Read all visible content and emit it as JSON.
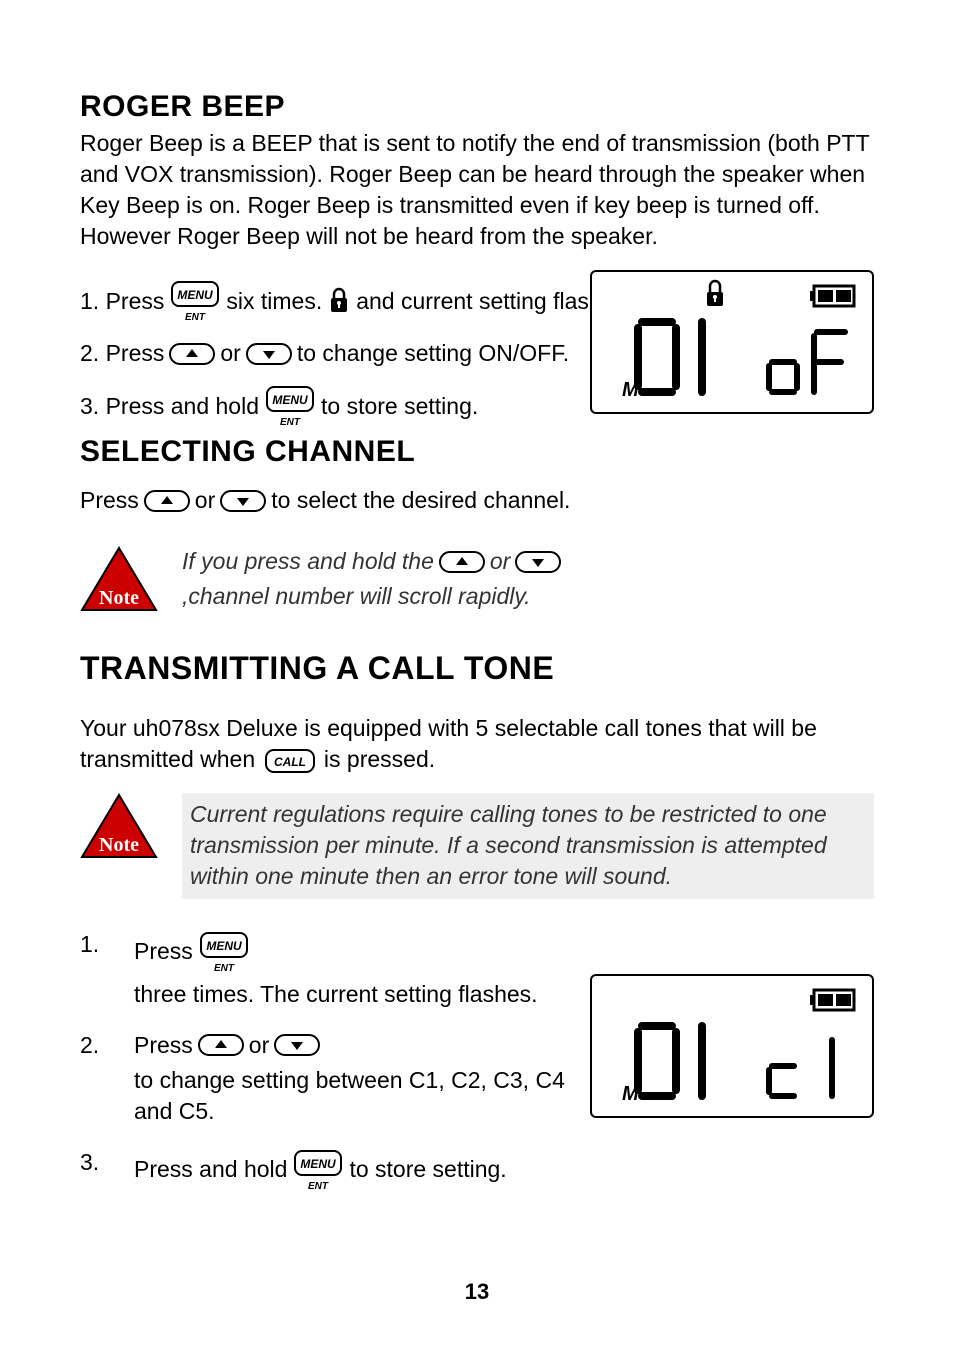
{
  "page_number": "13",
  "sections": {
    "roger_beep": {
      "title": "ROGER BEEP",
      "body": "Roger Beep is a BEEP that is sent to notify the end of transmission (both PTT and VOX transmission). Roger Beep can be heard through the speaker when Key Beep is on. Roger Beep is transmitted even if key beep is turned off. However Roger Beep will not be heard from the speaker.",
      "steps": {
        "s1a": "1. Press",
        "s1b": "six times.",
        "s1c": "and current setting flashes.",
        "s2a": "2. Press",
        "s2b": "or",
        "s2c": "to change setting ON/OFF.",
        "s3a": "3. Press and hold",
        "s3b": "to store setting."
      }
    },
    "selecting_channel": {
      "title": "SELECTING CHANNEL",
      "line_a": "Press",
      "line_b": "or",
      "line_c": "to select the desired channel.",
      "note_a": "If you press and hold the",
      "note_b": "or",
      "note_c": ",channel number will scroll rapidly."
    },
    "call_tone": {
      "title": "TRANSMITTING A CALL TONE",
      "intro_a": "Your uh078sx Deluxe is equipped with 5 selectable call tones that will be transmitted when",
      "intro_b": "is pressed.",
      "note": "Current regulations require calling tones to be restricted to one transmission per minute. If a second transmission is attempted within one minute then an error tone will sound.",
      "steps": {
        "s1a": "Press",
        "s1b": "three times. The current setting flashes.",
        "s2a": "Press",
        "s2b": "or",
        "s2c": "to change setting between C1, C2, C3, C4 and C5.",
        "s3a": "Press and hold",
        "s3b": "to store setting."
      }
    }
  },
  "icons": {
    "menu_label": "MENU",
    "ent_label": "ENT",
    "call_label": "CALL",
    "note_label": "Note"
  },
  "lcd": {
    "screen1": {
      "left": "0 1",
      "right": "oF",
      "m": "M",
      "lock": true,
      "battery": true
    },
    "screen2": {
      "left": "0 1",
      "right": "c 1",
      "m": "M",
      "lock": false,
      "battery": true
    }
  }
}
